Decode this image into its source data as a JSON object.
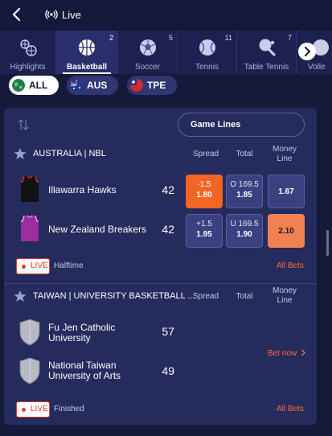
{
  "header": {
    "live_label": "Live"
  },
  "sport_tabs": [
    {
      "label": "Highlights",
      "count": "",
      "icon": "highlights-icon"
    },
    {
      "label": "Basketball",
      "count": "2",
      "icon": "basketball-icon",
      "active": true
    },
    {
      "label": "Soccer",
      "count": "5",
      "icon": "soccer-icon"
    },
    {
      "label": "Tennis",
      "count": "11",
      "icon": "tennis-icon"
    },
    {
      "label": "Table Tennis",
      "count": "7",
      "icon": "table-tennis-icon"
    },
    {
      "label": "Volle",
      "count": "",
      "icon": "volleyball-icon"
    }
  ],
  "filters": [
    {
      "label": "ALL",
      "flag": "globe",
      "active": true
    },
    {
      "label": "AUS",
      "flag": "australia"
    },
    {
      "label": "TPE",
      "flag": "taiwan"
    }
  ],
  "market_selector": "Game Lines",
  "columns": {
    "spread": "Spread",
    "total": "Total",
    "moneyline_top": "Money",
    "moneyline_bottom": "Line"
  },
  "events": [
    {
      "league": "AUSTRALIA | NBL",
      "teams": [
        {
          "name": "Illawarra Hawks",
          "score": "42",
          "spread_line": "-1.5",
          "spread_odds": "1.80",
          "total_line": "O 169.5",
          "total_odds": "1.85",
          "moneyline": "1.67"
        },
        {
          "name": "New Zealand Breakers",
          "score": "42",
          "spread_line": "+1.5",
          "spread_odds": "1.95",
          "total_line": "U 169.5",
          "total_odds": "1.90",
          "moneyline": "2.10"
        }
      ],
      "live_badge": "LIVE",
      "status": "Halftime",
      "all_bets": "All Bets"
    },
    {
      "league": "TAIWAN | UNIVERSITY BASKETBALL ...",
      "teams": [
        {
          "name_line1": "Fu Jen Catholic",
          "name_line2": "University",
          "score": "57"
        },
        {
          "name_line1": "National Taiwan",
          "name_line2": "University of Arts",
          "score": "49"
        }
      ],
      "bet_now": "Bet now",
      "live_badge": "LIVE",
      "status": "Finished",
      "all_bets": "All Bets"
    }
  ],
  "colors": {
    "accent": "#f26522",
    "background": "#161a3a",
    "card": "#252b5c",
    "live_red": "#e2402b"
  }
}
